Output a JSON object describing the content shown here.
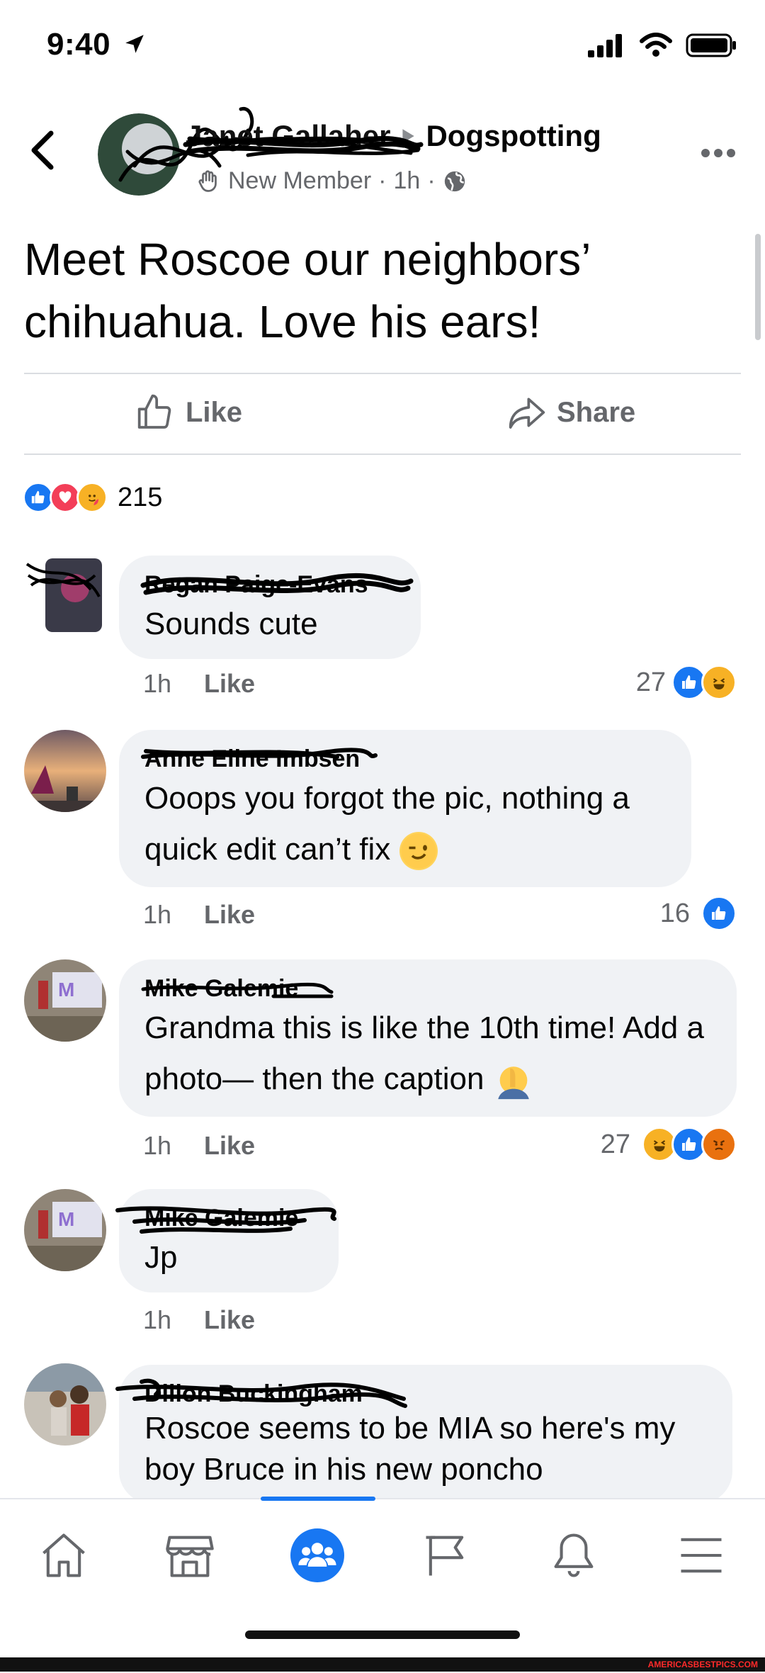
{
  "status_bar": {
    "time": "9:40"
  },
  "post": {
    "author": "Janet Gallaher",
    "group": "Dogspotting",
    "badge": "New Member",
    "time": "1h",
    "text": "Meet Roscoe our neighbors’ chihuahua. Love his ears!",
    "like_label": "Like",
    "share_label": "Share",
    "reaction_count": "215"
  },
  "comments": [
    {
      "name": "Regan Paige-Evans",
      "text": "Sounds cute",
      "time": "1h",
      "like_label": "Like",
      "reaction_count": "27",
      "reactions": [
        "like-icon",
        "laugh-icon"
      ]
    },
    {
      "name": "Anne Eline Imbsen",
      "text": "Ooops you forgot the pic, nothing a quick edit can’t fix",
      "time": "1h",
      "like_label": "Like",
      "reaction_count": "16",
      "reactions": [
        "like-icon"
      ]
    },
    {
      "name": "Mike Galemie",
      "text": "Grandma this is like the 10th time! Add a photo— then the caption",
      "time": "1h",
      "like_label": "Like",
      "reaction_count": "27",
      "reactions": [
        "laugh-icon",
        "like-icon",
        "angry-icon"
      ]
    },
    {
      "name": "Mike Galemie",
      "text": "Jp",
      "time": "1h",
      "like_label": "Like"
    },
    {
      "name": "Dillon Buckingham",
      "text": "Roscoe seems to be MIA so here's my boy Bruce in his new poncho"
    }
  ],
  "nav": [
    "home-icon",
    "marketplace-icon",
    "groups-icon",
    "pages-icon",
    "notifications-icon",
    "menu-icon"
  ],
  "watermark": "AMERICASBESTPICS.COM",
  "colors": {
    "accent": "#1877f2",
    "secondary_text": "#65676b",
    "bubble": "#f0f2f5"
  }
}
